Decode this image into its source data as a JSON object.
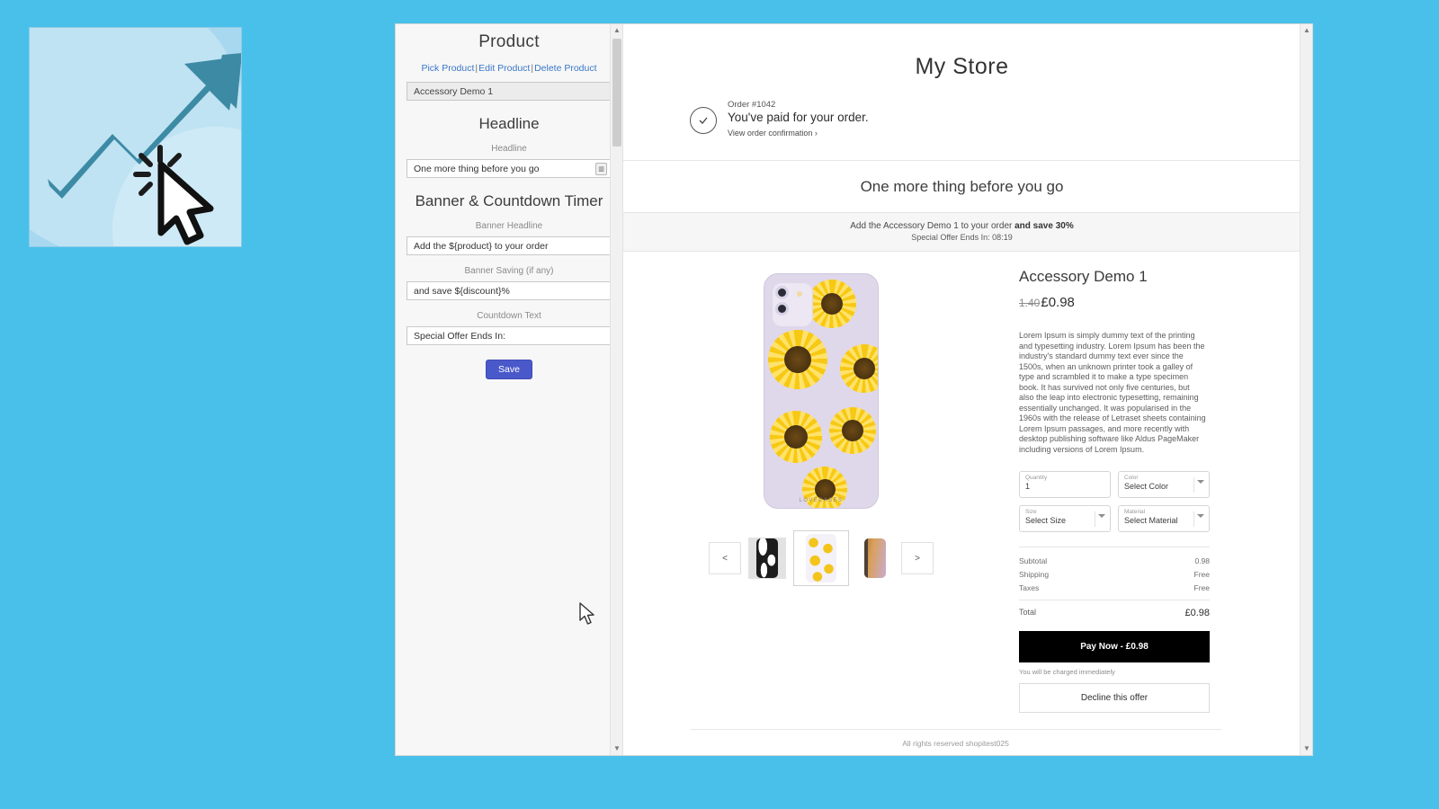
{
  "logo": {
    "name": "growth-arrow-click-logo"
  },
  "editor": {
    "product_section": {
      "heading": "Product",
      "links": [
        {
          "label": "Pick Product"
        },
        {
          "label": "Edit Product"
        },
        {
          "label": "Delete Product"
        }
      ],
      "separator": "|",
      "selected_product": "Accessory Demo 1"
    },
    "headline_section": {
      "heading": "Headline",
      "label": "Headline",
      "value": "One more thing before you go",
      "emoji_icon": "emoji-picker-icon"
    },
    "banner_section": {
      "heading": "Banner & Countdown Timer",
      "banner_headline_label": "Banner Headline",
      "banner_headline_value": "Add the ${product} to your order",
      "banner_saving_label": "Banner Saving (if any)",
      "banner_saving_value": "and save ${discount}%",
      "countdown_label": "Countdown Text",
      "countdown_value": "Special Offer Ends In:"
    },
    "save_label": "Save",
    "save_color": "#4a59c9"
  },
  "preview": {
    "store_title": "My Store",
    "order": {
      "number": "Order #1042",
      "status": "You've paid for your order.",
      "link": "View order confirmation ›",
      "check_icon": "check-circle-icon"
    },
    "upsell_headline": "One more thing before you go",
    "promo": {
      "line1_prefix": "Add the Accessory Demo 1 to your order ",
      "line1_bold": "and save 30%",
      "line2": "Special Offer Ends In: 08:19"
    },
    "gallery": {
      "prev_label": "<",
      "next_label": ">",
      "thumbnails": [
        {
          "name": "thumbnail-marble-case",
          "style": "marble",
          "selected": false
        },
        {
          "name": "thumbnail-sunflower-case",
          "style": "sun",
          "selected": true
        },
        {
          "name": "thumbnail-wood-case",
          "style": "wood",
          "selected": false
        }
      ],
      "hero_brand": "LOVECASES"
    },
    "product": {
      "name": "Accessory Demo 1",
      "price_old": "1.40",
      "price_new": "£0.98",
      "description": "Lorem Ipsum is simply dummy text of the printing and typesetting industry. Lorem Ipsum has been the industry's standard dummy text ever since the 1500s, when an unknown printer took a galley of type and scrambled it to make a type specimen book. It has survived not only five centuries, but also the leap into electronic typesetting, remaining essentially unchanged. It was popularised in the 1960s with the release of Letraset sheets containing Lorem Ipsum passages, and more recently with desktop publishing software like Aldus PageMaker including versions of Lorem Ipsum."
    },
    "fields": {
      "quantity_label": "Quantity",
      "quantity_value": "1",
      "color_label": "Color",
      "color_value": "Select Color",
      "size_label": "Size",
      "size_value": "Select Size",
      "material_label": "Material",
      "material_value": "Select Material"
    },
    "summary": {
      "subtotal_label": "Subtotal",
      "subtotal_value": "0.98",
      "shipping_label": "Shipping",
      "shipping_value": "Free",
      "taxes_label": "Taxes",
      "taxes_value": "Free",
      "total_label": "Total",
      "total_value": "£0.98"
    },
    "actions": {
      "pay_label": "Pay Now - £0.98",
      "charge_note": "You will be charged immediately",
      "decline_label": "Decline this offer"
    },
    "footer": "All rights reserved shopitest025"
  }
}
